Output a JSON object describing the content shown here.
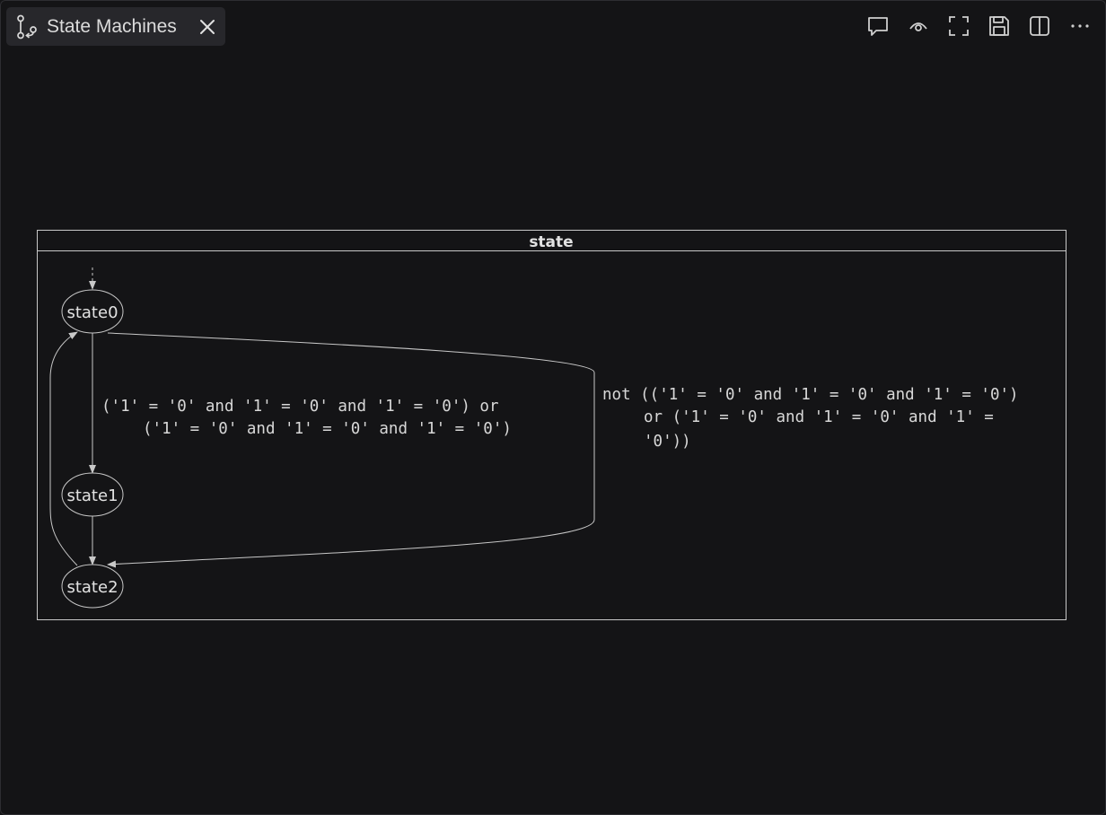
{
  "tab": {
    "title": "State Machines",
    "icon": "git-branch-icon",
    "close_icon": "close-icon"
  },
  "toolbar": {
    "items": [
      {
        "name": "comment-icon"
      },
      {
        "name": "eye-icon"
      },
      {
        "name": "fullscreen-icon"
      },
      {
        "name": "save-icon"
      },
      {
        "name": "split-view-icon"
      },
      {
        "name": "more-icon"
      }
    ]
  },
  "diagram": {
    "container_label": "state",
    "states": [
      {
        "id": "state0",
        "label": "state0"
      },
      {
        "id": "state1",
        "label": "state1"
      },
      {
        "id": "state2",
        "label": "state2"
      }
    ],
    "transitions": [
      {
        "from": "state0",
        "to": "state1",
        "label_lines": [
          "('1' = '0' and '1' = '0' and '1' = '0') or",
          "('1' = '0' and '1' = '0' and '1' = '0')"
        ]
      },
      {
        "from": "state0",
        "to": "state2",
        "label_lines": [
          "not (('1' = '0' and '1' = '0' and '1' = '0')",
          "or ('1' = '0' and '1' = '0' and '1' =",
          "'0'))"
        ]
      },
      {
        "from": "state1",
        "to": "state2",
        "label_lines": []
      },
      {
        "from": "state2",
        "to": "state0",
        "label_lines": []
      }
    ],
    "colors": {
      "background": "#141416",
      "stroke": "#c8c8c8",
      "text": "#e2e2e2",
      "tab_background": "#27272b"
    }
  }
}
